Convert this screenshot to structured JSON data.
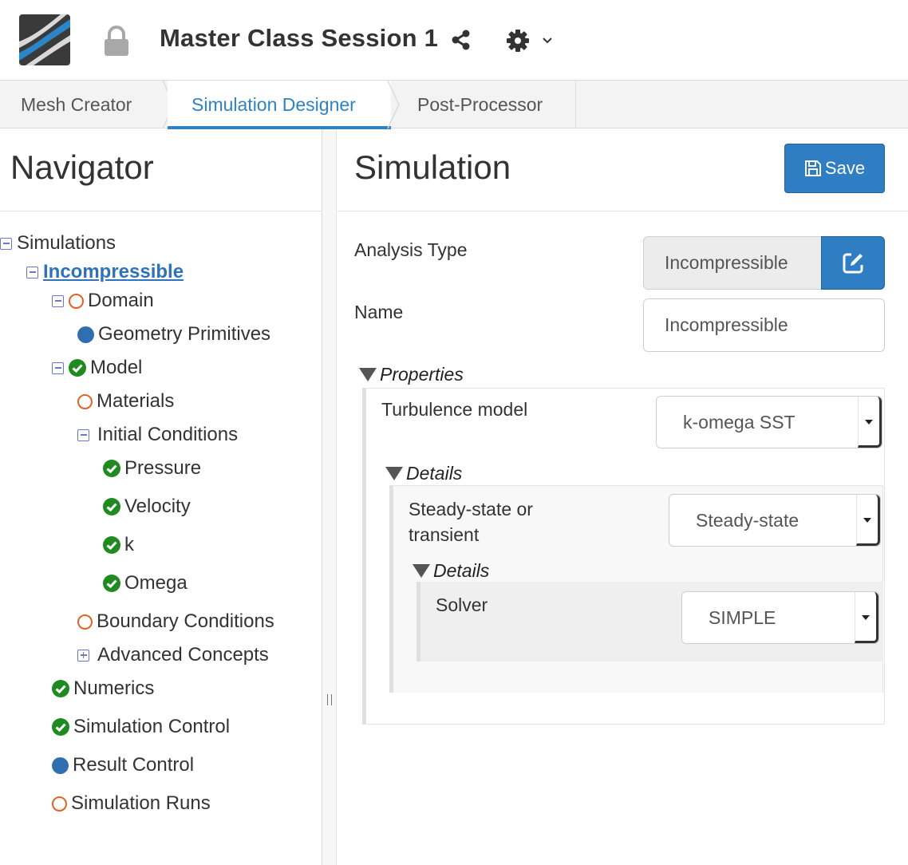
{
  "header": {
    "logo": "simscale-logo",
    "lock_icon": "lock-icon",
    "project_title": "Master Class Session 1",
    "share_icon": "share-icon",
    "settings_icon": "gear-icon",
    "dropdown_icon": "chevron-down-icon"
  },
  "tabs": [
    {
      "label": "Mesh Creator",
      "active": false
    },
    {
      "label": "Simulation Designer",
      "active": true
    },
    {
      "label": "Post-Processor",
      "active": false
    }
  ],
  "navigator": {
    "title": "Navigator",
    "tree": {
      "simulations": "Simulations",
      "incompressible": "Incompressible",
      "domain": "Domain",
      "geometry_primitives": "Geometry Primitives",
      "model": "Model",
      "materials": "Materials",
      "initial_conditions": "Initial Conditions",
      "pressure": "Pressure",
      "velocity": "Velocity",
      "k": "k",
      "omega": "Omega",
      "boundary_conditions": "Boundary Conditions",
      "advanced_concepts": "Advanced Concepts",
      "numerics": "Numerics",
      "simulation_control": "Simulation Control",
      "result_control": "Result Control",
      "simulation_runs": "Simulation Runs"
    },
    "status_colors": {
      "complete": "#1f8a1f",
      "incomplete": "#e0622a",
      "info": "#2f6fb0",
      "tree_toggle": "#6a78c9"
    }
  },
  "simulation": {
    "title": "Simulation",
    "save_label": "Save",
    "analysis_type_label": "Analysis Type",
    "analysis_type_value": "Incompressible",
    "name_label": "Name",
    "name_value": "Incompressible",
    "properties_label": "Properties",
    "turbulence_label": "Turbulence model",
    "turbulence_value": "k-omega SST",
    "details_label": "Details",
    "steady_label": "Steady-state or transient",
    "steady_value": "Steady-state",
    "details2_label": "Details",
    "solver_label": "Solver",
    "solver_value": "SIMPLE",
    "accent_color": "#2f7dc3"
  }
}
